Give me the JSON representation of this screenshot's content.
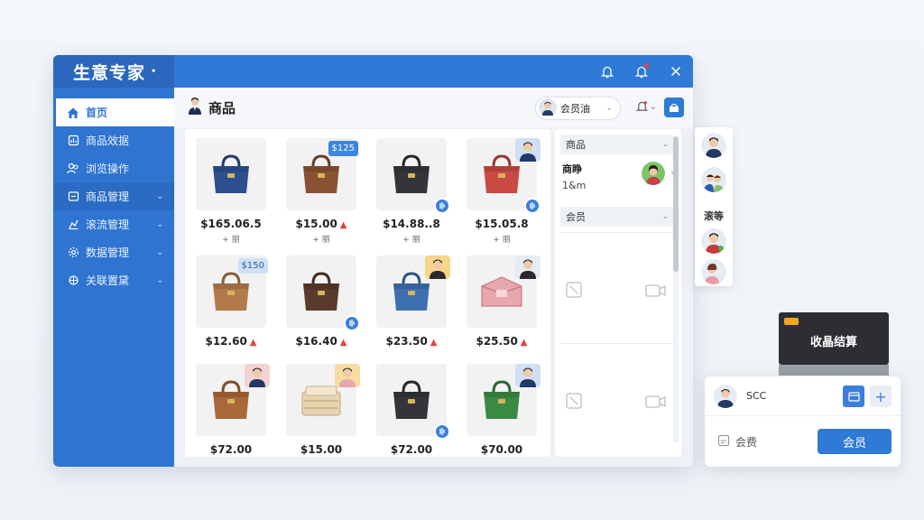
{
  "app": {
    "title": "生意专家",
    "title_marker": "•"
  },
  "colors": {
    "primary": "#2f74d0",
    "accent_red": "#e0443a",
    "checkout_bg": "#2c2e33"
  },
  "sidebar": {
    "items": [
      {
        "label": "首页",
        "icon": "home-icon"
      },
      {
        "label": "商品效据",
        "icon": "chart-doc-icon"
      },
      {
        "label": "浏览操作",
        "icon": "users-icon"
      },
      {
        "label": "商品管理",
        "icon": "box-icon",
        "chevron": "⌄"
      },
      {
        "label": "滚流管理",
        "icon": "flow-icon",
        "chevron": "⌄"
      },
      {
        "label": "数据管理",
        "icon": "gear-icon",
        "chevron": "⌄"
      },
      {
        "label": "关联置黛",
        "icon": "settings-icon",
        "chevron": "⌄"
      }
    ]
  },
  "topbar": {
    "icons": [
      "bell-icon",
      "notification-icon",
      "close-icon"
    ]
  },
  "header": {
    "title": "商品",
    "user_label": "会员油",
    "chevron": "⌄"
  },
  "products": [
    {
      "price": "$165.06.5",
      "stock": "+ 丽",
      "color": "#2d4f8f"
    },
    {
      "price": "$15.00",
      "stock": "+ 丽",
      "color": "#8a5233",
      "up": "▲",
      "tag": "$125"
    },
    {
      "price": "$14.88..8",
      "stock": "+ 丽",
      "color": "#333538"
    },
    {
      "price": "$15.05.8",
      "stock": "+ 丽",
      "color": "#c94a42"
    },
    {
      "price": "",
      "stock": "",
      "color": "#b27a4a",
      "tag": "$150"
    },
    {
      "price": "$16.40",
      "stock": "",
      "color": "#5a3a2c",
      "up": "▲"
    },
    {
      "price": "$23.50",
      "stock": "",
      "color": "#3f6fb0",
      "up": "▲"
    },
    {
      "price": "$25.50",
      "stock": "",
      "color": "#e7a7ae",
      "up": "▲"
    },
    {
      "price": "$12.60",
      "stock": "",
      "color": "#a8683a",
      "up": "▲"
    },
    {
      "price": "$72.00",
      "stock": "",
      "color": "#a8683a"
    },
    {
      "price": "$15.00",
      "stock": "",
      "color": "#e6d3b0"
    },
    {
      "price": "$72.00",
      "stock": "",
      "color": "#333538"
    },
    {
      "price": "$70.00",
      "stock": "",
      "color": "#3a8a44"
    }
  ],
  "right_panel": {
    "dropdown1": "商品",
    "product_name": "商睁",
    "product_sub": "1&m",
    "dropdown2": "会员",
    "chevron": "⌄",
    "arrow": "›"
  },
  "float_col": {
    "label": "滚等"
  },
  "checkout": {
    "label": "收晶结算"
  },
  "member_card": {
    "name": "SCC",
    "plus": "+",
    "label": "会费",
    "button": "会员"
  }
}
